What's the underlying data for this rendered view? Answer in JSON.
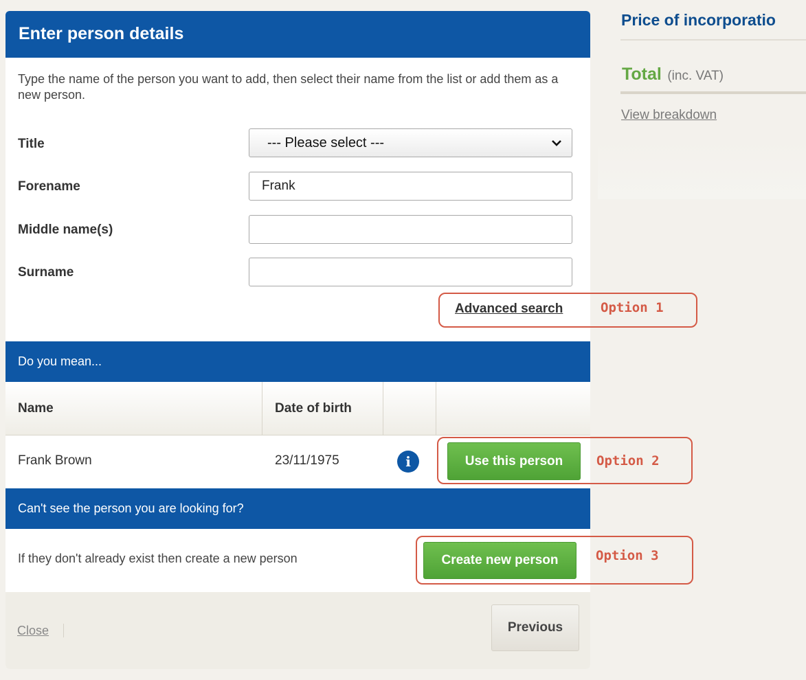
{
  "price_panel": {
    "title": "Price of incorporatio",
    "total_label": "Total",
    "total_sub": "(inc. VAT)",
    "view_breakdown": "View breakdown"
  },
  "modal": {
    "title": "Enter person details",
    "intro": "Type the name of the person you want to add, then select their name from the list or add them as a new person.",
    "form": {
      "title_label": "Title",
      "title_selected": "--- Please select ---",
      "forename_label": "Forename",
      "forename_value": "Frank",
      "middle_label": "Middle name(s)",
      "middle_value": "",
      "surname_label": "Surname",
      "surname_value": ""
    },
    "advanced_search": "Advanced search",
    "do_you_mean": "Do you mean...",
    "table": {
      "headers": [
        "Name",
        "Date of birth",
        "",
        ""
      ],
      "rows": [
        {
          "name": "Frank Brown",
          "dob": "23/11/1975",
          "info": "i",
          "action": "Use this person"
        }
      ]
    },
    "cant_see": "Can't see the person you are looking for?",
    "create_text": "If they don't already exist then create a new person",
    "create_button": "Create new person",
    "footer": {
      "close": "Close",
      "previous": "Previous"
    }
  },
  "annotations": {
    "option1": "Option 1",
    "option2": "Option 2",
    "option3": "Option 3",
    "color": "#d45a46"
  },
  "colors": {
    "brand_blue": "#0e57a5",
    "green": "#5cb040",
    "background": "#f3f1ec"
  }
}
